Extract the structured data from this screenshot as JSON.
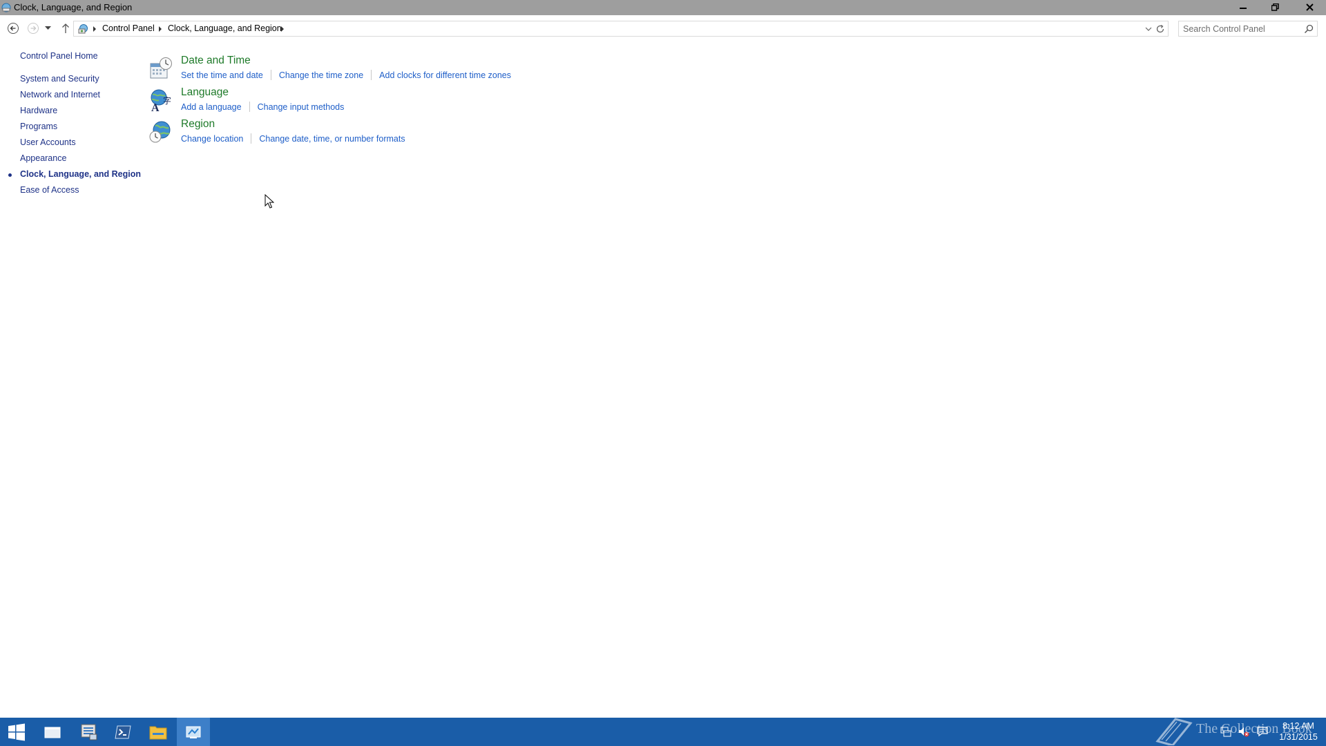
{
  "window": {
    "title": "Clock, Language, and Region"
  },
  "address_bar": {
    "breadcrumbs": [
      "Control Panel",
      "Clock, Language, and Region"
    ]
  },
  "search": {
    "placeholder": "Search Control Panel"
  },
  "sidebar": {
    "home": "Control Panel Home",
    "items": [
      {
        "label": "System and Security"
      },
      {
        "label": "Network and Internet"
      },
      {
        "label": "Hardware"
      },
      {
        "label": "Programs"
      },
      {
        "label": "User Accounts"
      },
      {
        "label": "Appearance"
      },
      {
        "label": "Clock, Language, and Region",
        "current": true
      },
      {
        "label": "Ease of Access"
      }
    ]
  },
  "categories": [
    {
      "title": "Date and Time",
      "icon": "clock-calendar-icon",
      "links": [
        "Set the time and date",
        "Change the time zone",
        "Add clocks for different time zones"
      ]
    },
    {
      "title": "Language",
      "icon": "language-globe-icon",
      "links": [
        "Add a language",
        "Change input methods"
      ]
    },
    {
      "title": "Region",
      "icon": "region-globe-icon",
      "links": [
        "Change location",
        "Change date, time, or number formats"
      ]
    }
  ],
  "taskbar": {
    "pinned": [
      "start-button",
      "task-view",
      "server-manager",
      "powershell",
      "file-explorer",
      "control-panel"
    ],
    "active": "control-panel",
    "clock_time": "8:12 AM",
    "clock_date": "1/31/2015"
  },
  "watermark": {
    "text": "The Collection Book"
  },
  "colors": {
    "titlebar": "#9e9e9e",
    "taskbar": "#1a5da8",
    "category_title": "#1e7a29",
    "link": "#1e5ec8",
    "nav_link": "#1e3287"
  }
}
